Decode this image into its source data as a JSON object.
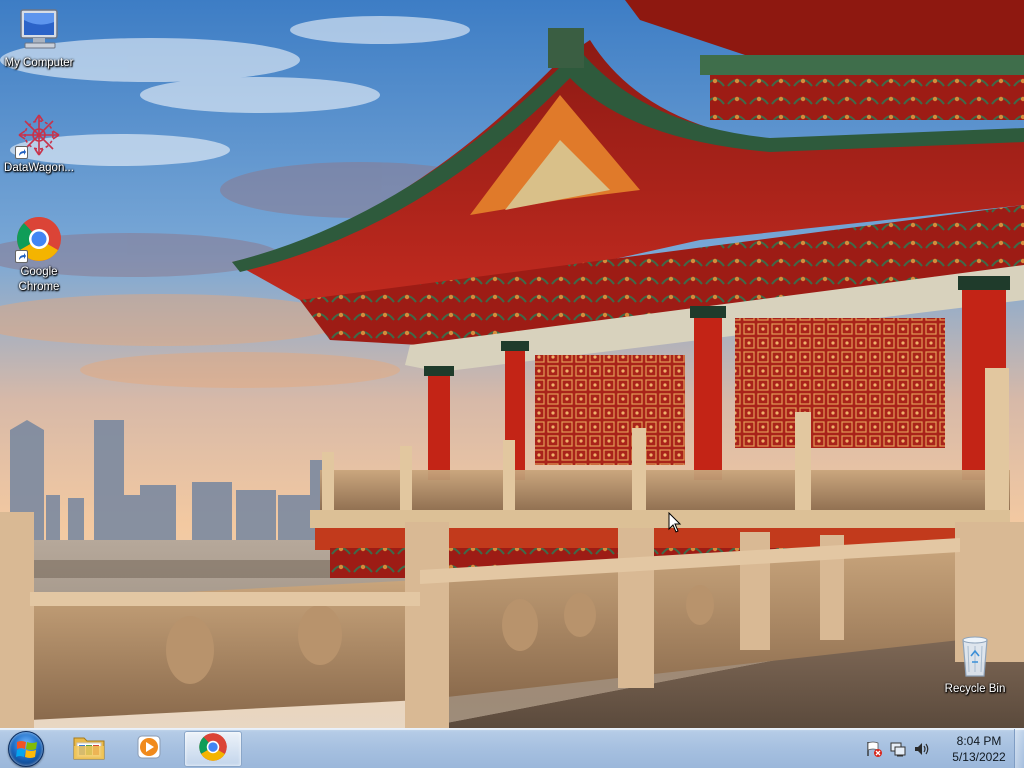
{
  "desktop": {
    "icons": [
      {
        "label": "My Computer",
        "icon": "computer-monitor-icon",
        "shortcut": false
      },
      {
        "label": "DataWagon...",
        "icon": "datawagon-snowflake-icon",
        "shortcut": true
      },
      {
        "label": "Google Chrome",
        "icon": "chrome-icon",
        "shortcut": true
      },
      {
        "label": "Recycle Bin",
        "icon": "recycle-bin-icon",
        "shortcut": false
      }
    ]
  },
  "taskbar": {
    "start": {
      "icon": "windows-orb-icon"
    },
    "pinned": [
      {
        "name": "Windows Explorer",
        "icon": "folder-icon",
        "active": false
      },
      {
        "name": "Windows Media Player",
        "icon": "media-player-icon",
        "active": false
      },
      {
        "name": "Google Chrome",
        "icon": "chrome-icon",
        "active": true
      }
    ],
    "tray": {
      "icons": [
        "action-center-flag-icon",
        "network-icon",
        "volume-icon"
      ],
      "time": "8:04 PM",
      "date": "5/13/2022"
    }
  },
  "colors": {
    "sky_top": "#3f7fc6",
    "sky_bottom": "#f2c9a4",
    "pavilion_red": "#b0201a",
    "taskbar": "#a6c0e0",
    "chrome_red": "#db4437",
    "chrome_yellow": "#f4b400",
    "chrome_green": "#0f9d58",
    "chrome_blue": "#4285f4"
  }
}
